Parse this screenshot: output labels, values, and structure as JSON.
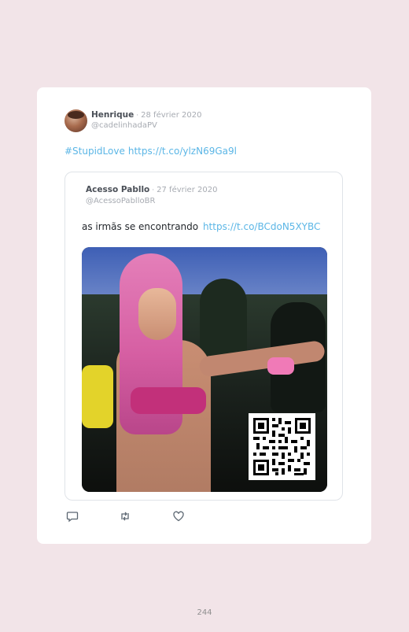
{
  "tweet": {
    "author": {
      "name": "Henrique",
      "separator": "·",
      "date": "28 février 2020",
      "handle": "@cadelinhadaPV"
    },
    "text": {
      "hashtag": "#StupidLove",
      "link": "https://t.co/ylzN69Ga9l"
    },
    "quoted": {
      "author": {
        "name": "Acesso Pabllo",
        "separator": "·",
        "date": "27 février 2020",
        "handle": "@AcessoPablloBR"
      },
      "text": "as irmãs se encontrando",
      "link": "https://t.co/BCdoN5XYBC"
    },
    "actions": [
      {
        "icon": "reply-icon"
      },
      {
        "icon": "retweet-icon"
      },
      {
        "icon": "like-icon"
      }
    ]
  },
  "page_number": "244",
  "colors": {
    "background": "#f2e4e8",
    "card": "#ffffff",
    "link": "#5bb6e6",
    "muted": "#a7abb2",
    "name": "#4a4f57"
  }
}
